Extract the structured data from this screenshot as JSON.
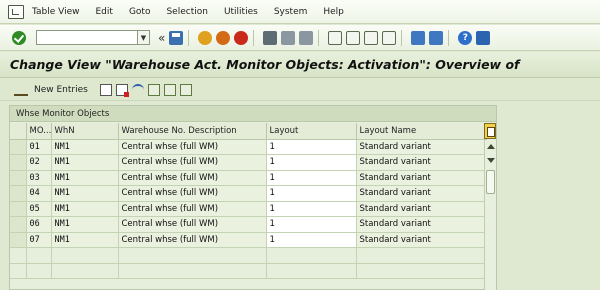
{
  "menu": {
    "items": [
      "Table View",
      "Edit",
      "Goto",
      "Selection",
      "Utilities",
      "System",
      "Help"
    ]
  },
  "toolbar": {
    "command_value": "",
    "double_arrow": "«"
  },
  "title": "Change View \"Warehouse Act. Monitor Objects: Activation\": Overview of",
  "app_toolbar": {
    "new_entries_label": "New Entries"
  },
  "table": {
    "section_title": "Whse Monitor Objects",
    "columns": [
      "MO...",
      "WhN",
      "Warehouse No. Description",
      "Layout",
      "Layout Name"
    ],
    "rows": [
      [
        "01",
        "NM1",
        "Central whse (full WM)",
        "1",
        "Standard variant"
      ],
      [
        "02",
        "NM1",
        "Central whse (full WM)",
        "1",
        "Standard variant"
      ],
      [
        "03",
        "NM1",
        "Central whse (full WM)",
        "1",
        "Standard variant"
      ],
      [
        "04",
        "NM1",
        "Central whse (full WM)",
        "1",
        "Standard variant"
      ],
      [
        "05",
        "NM1",
        "Central whse (full WM)",
        "1",
        "Standard variant"
      ],
      [
        "06",
        "NM1",
        "Central whse (full WM)",
        "1",
        "Standard variant"
      ],
      [
        "07",
        "NM1",
        "Central whse (full WM)",
        "1",
        "Standard variant"
      ]
    ]
  },
  "colors": {
    "background": "#dfe9d2",
    "ok_green": "#2f8a25",
    "cancel_red": "#c92a1a"
  },
  "icons": {
    "menu": "app-window-icon",
    "ok": "checkmark-icon",
    "save": "save-icon",
    "back": "back-icon",
    "exit": "exit-icon",
    "cancel": "cancel-icon",
    "print": "print-icon",
    "find": "find-icon",
    "find_next": "find-next-icon",
    "first_page": "first-page-icon",
    "prev_page": "previous-page-icon",
    "next_page": "next-page-icon",
    "last_page": "last-page-icon",
    "create_session": "create-session-icon",
    "shortcut": "shortcut-icon",
    "help": "help-icon",
    "customize": "customize-layout-icon",
    "display_change": "glasses-edit-icon",
    "copy": "copy-icon",
    "delete": "delete-icon",
    "undo": "undo-icon",
    "select_all": "select-all-icon",
    "select_block": "select-block-icon",
    "deselect": "deselect-all-icon",
    "table_settings": "table-settings-icon"
  }
}
